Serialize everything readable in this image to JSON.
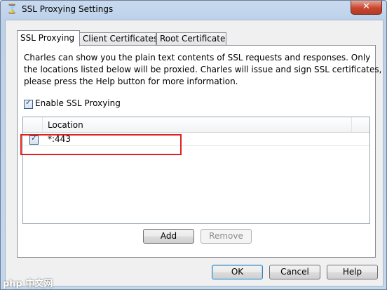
{
  "window": {
    "title": "SSL Proxying Settings",
    "close_label": "✕"
  },
  "tabs": [
    {
      "label": "SSL Proxying",
      "active": true
    },
    {
      "label": "Client Certificates",
      "active": false
    },
    {
      "label": "Root Certificate",
      "active": false
    }
  ],
  "description": [
    "Charles can show you the plain text contents of SSL requests and responses. Only",
    "the locations listed below will be proxied. Charles will issue and sign SSL certificates,",
    "please press the Help button for more information."
  ],
  "enable_ssl_proxying": {
    "label": "Enable SSL Proxying",
    "checked": true
  },
  "locations_table": {
    "column_header": "Location",
    "rows": [
      {
        "checked": true,
        "location": "*:443"
      }
    ]
  },
  "list_buttons": {
    "add": "Add",
    "remove": "Remove"
  },
  "dialog_buttons": {
    "ok": "OK",
    "cancel": "Cancel",
    "help": "Help"
  },
  "watermark": {
    "text": "php 中文网"
  },
  "colors": {
    "highlight_box": "#e02020",
    "close_button": "#c7462f"
  }
}
